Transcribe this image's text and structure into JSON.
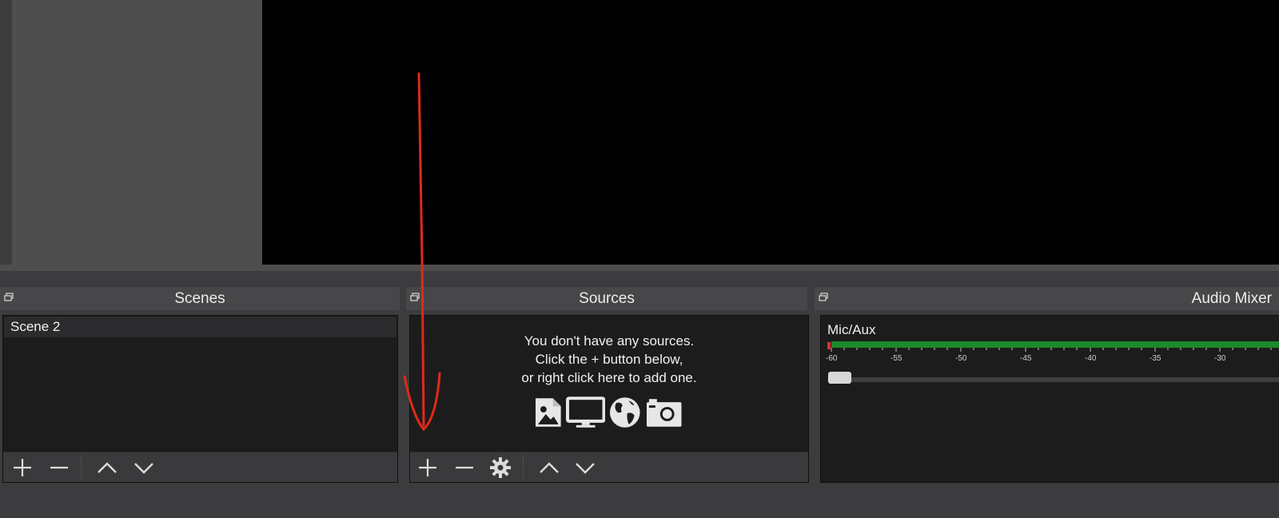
{
  "docks": {
    "scenes": {
      "title": "Scenes",
      "items": [
        "Scene 2"
      ]
    },
    "sources": {
      "title": "Sources",
      "empty_message": [
        "You don't have any sources.",
        "Click the + button below,",
        "or right click here to add one."
      ],
      "empty_icons": [
        "image-icon",
        "monitor-icon",
        "globe-icon",
        "camera-icon"
      ]
    },
    "audio_mixer": {
      "title": "Audio Mixer",
      "track": {
        "name": "Mic/Aux",
        "scale": [
          "-60",
          "-55",
          "-50",
          "-45",
          "-40",
          "-35",
          "-30"
        ]
      }
    }
  },
  "colors": {
    "background": "#3c3b3d",
    "panel": "#1c1c1c",
    "meter": "#1a8a2a",
    "annotation_arrow": "#e02a1a"
  }
}
